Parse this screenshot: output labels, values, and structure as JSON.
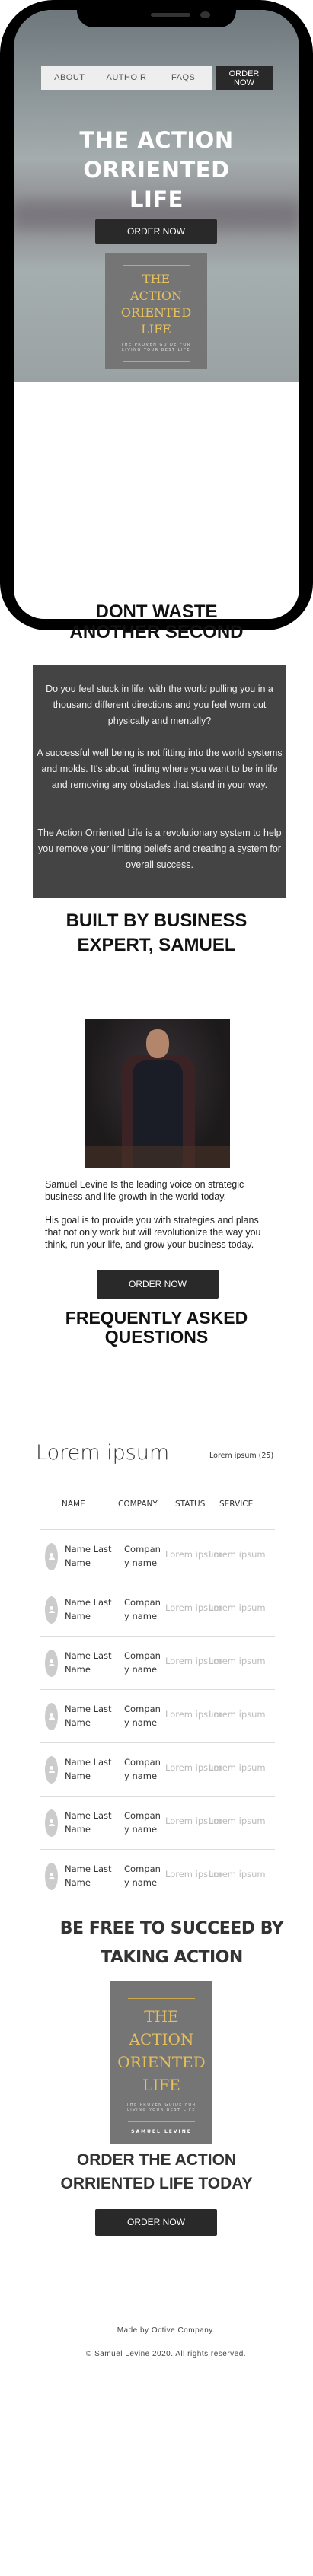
{
  "nav": {
    "items": [
      "ABOUT",
      "AUTHO R",
      "FAQS"
    ],
    "order": "ORDER NOW"
  },
  "hero": {
    "title_lines": [
      "THE ACTION",
      "ORRIENTED",
      "LIFE"
    ],
    "cta": "ORDER NOW"
  },
  "book": {
    "title_lines": [
      "THE",
      "ACTION",
      "ORIENTED",
      "LIFE"
    ],
    "subtitle_lines": [
      "THE PROVEN GUIDE FOR",
      "LIVING YOUR BEST LIFE"
    ],
    "author": "SAMUEL LEVINE"
  },
  "section1": {
    "heading_lines": [
      "DONT  WASTE",
      "ANOTHER SECOND"
    ],
    "paragraphs": [
      "Do you feel stuck in life, with the world pulling you in a thousand different directions and you feel worn out physically and mentally?",
      "A successful well being is not fitting into the world systems and molds. It's about finding where you want to be in life and removing any obstacles that stand in your way.",
      "The  Action Orriented Life is a revolutionary system to help you remove your limiting beliefs and creating a system for overall success."
    ]
  },
  "author": {
    "heading_lines": [
      "BUILT BY BUSINESS",
      "EXPERT, SAMUEL"
    ],
    "paragraphs": [
      "Samuel Levine Is the leading voice on strategic business and life growth in the world today.",
      "His goal is to provide you with strategies and plans that not only work but will revolutionize the way you think, run your life, and grow your business today."
    ],
    "cta": "ORDER NOW"
  },
  "faq": {
    "heading_lines": [
      "FREQUENTLY ASKED",
      "QUESTIONS"
    ],
    "table_title": "Lorem ipsum",
    "count": "Lorem ipsum (25)",
    "columns": [
      "NAME",
      "COMPANY",
      "STATUS",
      "SERVICE"
    ],
    "rows": [
      {
        "name": "Name Last Name",
        "company": "Company name",
        "status": "Lorem ipsum",
        "service": "Lorem ipsum"
      },
      {
        "name": "Name Last Name",
        "company": "Company name",
        "status": "Lorem ipsum",
        "service": "Lorem ipsum"
      },
      {
        "name": "Name Last Name",
        "company": "Company name",
        "status": "Lorem ipsum",
        "service": "Lorem ipsum"
      },
      {
        "name": "Name Last Name",
        "company": "Company name",
        "status": "Lorem ipsum",
        "service": "Lorem ipsum"
      },
      {
        "name": "Name Last Name",
        "company": "Company name",
        "status": "Lorem ipsum",
        "service": "Lorem ipsum"
      },
      {
        "name": "Name Last Name",
        "company": "Company name",
        "status": "Lorem ipsum",
        "service": "Lorem ipsum"
      },
      {
        "name": "Name Last Name",
        "company": "Company name",
        "status": "Lorem ipsum",
        "service": "Lorem ipsum"
      }
    ]
  },
  "free": {
    "heading_lines": [
      "BE FREE TO SUCCEED BY",
      "TAKING ACTION"
    ]
  },
  "order": {
    "heading_lines": [
      "ORDER THE ACTION",
      "ORRIENTED LIFE TODAY"
    ],
    "cta": "ORDER NOW"
  },
  "footer": {
    "made_by": "Made by Octive Company.",
    "copyright": "© Samuel Levine 2020. All rights reserved."
  },
  "colors": {
    "dark": "#292929",
    "panel": "#444444",
    "gold": "#e6c05a",
    "book": "#757575"
  }
}
